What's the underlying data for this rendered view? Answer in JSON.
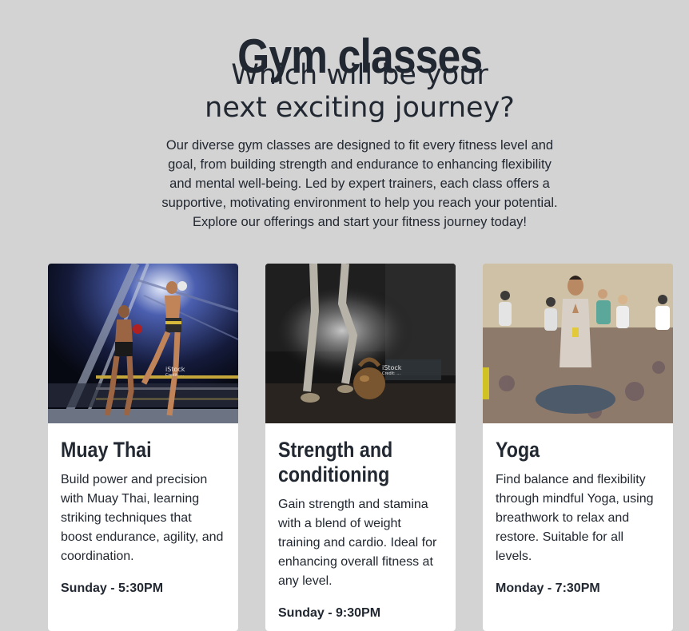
{
  "page": {
    "title": "Gym classes",
    "subtitle": "Which will be your next exciting journey?",
    "intro": "Our diverse gym classes are designed to fit every fitness level and goal, from building strength and endurance to enhancing flexibility and mental well-being. Led by expert trainers, each class offers a supportive, motivating environment to help you reach your potential. Explore our offerings and start your fitness journey today!"
  },
  "classes": [
    {
      "title": "Muay Thai",
      "description": "Build power and precision with Muay Thai, learning striking techniques that boost endurance, agility, and coordination.",
      "schedule": "Sunday - 5:30PM",
      "watermark": "iStock",
      "watermark_credit": "Credit: ..."
    },
    {
      "title": "Strength and conditioning",
      "description": "Gain strength and stamina with a blend of weight training and cardio. Ideal for enhancing overall fitness at any level.",
      "schedule": "Sunday - 9:30PM",
      "watermark": "iStock",
      "watermark_credit": "Credit: ..."
    },
    {
      "title": "Yoga",
      "description": "Find balance and flexibility through mindful Yoga, using breathwork to relax and restore. Suitable for all levels.",
      "schedule": "Monday - 7:30PM"
    }
  ]
}
